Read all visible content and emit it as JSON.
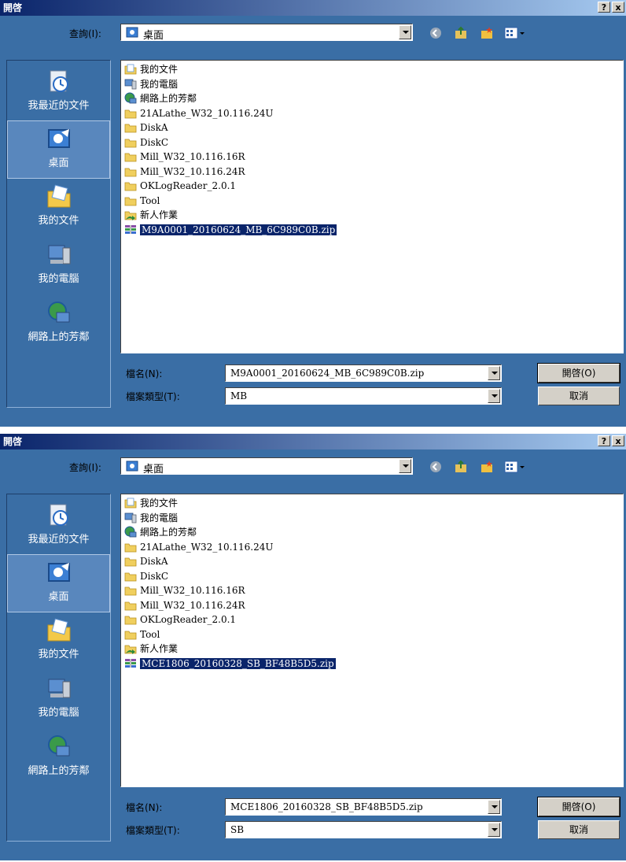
{
  "dialogs": [
    {
      "title": "開啓",
      "help_glyph": "?",
      "close_glyph": "x",
      "look_in_label": "查詢(I):",
      "look_in_value": "桌面",
      "places": [
        "我最近的文件",
        "桌面",
        "我的文件",
        "我的電腦",
        "網路上的芳鄰"
      ],
      "files": [
        {
          "name": "我的文件",
          "icon": "documents-icon"
        },
        {
          "name": "我的電腦",
          "icon": "computer-icon"
        },
        {
          "name": "網路上的芳鄰",
          "icon": "network-icon"
        },
        {
          "name": "21ALathe_W32_10.116.24U",
          "icon": "folder-icon"
        },
        {
          "name": "DiskA",
          "icon": "folder-icon"
        },
        {
          "name": "DiskC",
          "icon": "folder-icon"
        },
        {
          "name": "Mill_W32_10.116.16R",
          "icon": "folder-icon"
        },
        {
          "name": "Mill_W32_10.116.24R",
          "icon": "folder-icon"
        },
        {
          "name": "OKLogReader_2.0.1",
          "icon": "folder-icon"
        },
        {
          "name": "Tool",
          "icon": "folder-icon"
        },
        {
          "name": "新人作業",
          "icon": "shared-folder-icon"
        },
        {
          "name": "M9A0001_20160624_MB_6C989C0B.zip",
          "icon": "zip-archive-icon",
          "selected": true
        }
      ],
      "filename_label": "檔名(N):",
      "filename_value": "M9A0001_20160624_MB_6C989C0B.zip",
      "filetype_label": "檔案類型(T):",
      "filetype_value": "MB",
      "open_button": "開啓(O)",
      "cancel_button": "取消"
    },
    {
      "title": "開啓",
      "help_glyph": "?",
      "close_glyph": "x",
      "look_in_label": "查詢(I):",
      "look_in_value": "桌面",
      "places": [
        "我最近的文件",
        "桌面",
        "我的文件",
        "我的電腦",
        "網路上的芳鄰"
      ],
      "files": [
        {
          "name": "我的文件",
          "icon": "documents-icon"
        },
        {
          "name": "我的電腦",
          "icon": "computer-icon"
        },
        {
          "name": "網路上的芳鄰",
          "icon": "network-icon"
        },
        {
          "name": "21ALathe_W32_10.116.24U",
          "icon": "folder-icon"
        },
        {
          "name": "DiskA",
          "icon": "folder-icon"
        },
        {
          "name": "DiskC",
          "icon": "folder-icon"
        },
        {
          "name": "Mill_W32_10.116.16R",
          "icon": "folder-icon"
        },
        {
          "name": "Mill_W32_10.116.24R",
          "icon": "folder-icon"
        },
        {
          "name": "OKLogReader_2.0.1",
          "icon": "folder-icon"
        },
        {
          "name": "Tool",
          "icon": "folder-icon"
        },
        {
          "name": "新人作業",
          "icon": "shared-folder-icon"
        },
        {
          "name": "MCE1806_20160328_SB_BF48B5D5.zip",
          "icon": "zip-archive-icon",
          "selected": true
        }
      ],
      "filename_label": "檔名(N):",
      "filename_value": "MCE1806_20160328_SB_BF48B5D5.zip",
      "filetype_label": "檔案類型(T):",
      "filetype_value": "SB",
      "open_button": "開啓(O)",
      "cancel_button": "取消"
    }
  ],
  "colors": {
    "title_start": "#0a246a",
    "dialog_bg": "#3a6ea5",
    "selection": "#0a246a"
  }
}
